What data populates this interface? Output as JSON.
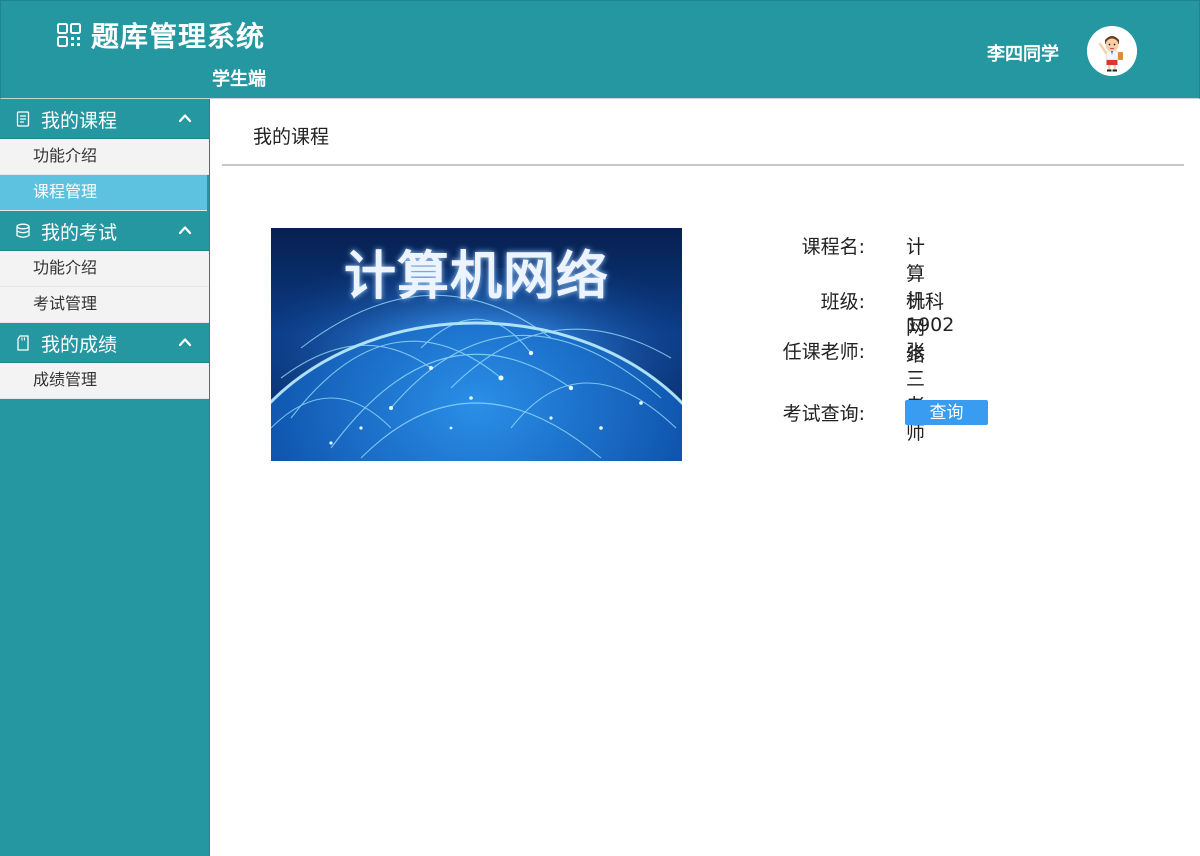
{
  "header": {
    "title": "题库管理系统",
    "subtitle": "学生端",
    "user_name": "李四同学",
    "logo_icon": "qr-grid-icon",
    "avatar_icon": "cartoon-boy-avatar",
    "background_color": "#2597a1"
  },
  "sidebar": {
    "groups": [
      {
        "label": "我的课程",
        "icon": "document-icon",
        "expanded": true,
        "items": [
          {
            "label": "功能介绍",
            "active": false
          },
          {
            "label": "课程管理",
            "active": true
          }
        ]
      },
      {
        "label": "我的考试",
        "icon": "database-icon",
        "expanded": true,
        "items": [
          {
            "label": "功能介绍",
            "active": false
          },
          {
            "label": "考试管理",
            "active": false
          }
        ]
      },
      {
        "label": "我的成绩",
        "icon": "sd-card-icon",
        "expanded": true,
        "items": [
          {
            "label": "成绩管理",
            "active": false
          }
        ]
      }
    ],
    "active_item_color": "#5cc2e0"
  },
  "main": {
    "title": "我的课程",
    "course": {
      "image_text": "计算机网络",
      "fields": [
        {
          "label": "课程名:",
          "value": "计算机网络"
        },
        {
          "label": "班级:",
          "value": "计科1902"
        },
        {
          "label": "任课老师:",
          "value": "张三老师"
        },
        {
          "label": "考试查询:",
          "value": ""
        }
      ],
      "query_button_label": "查询",
      "query_button_color": "#3a9cf0"
    }
  }
}
